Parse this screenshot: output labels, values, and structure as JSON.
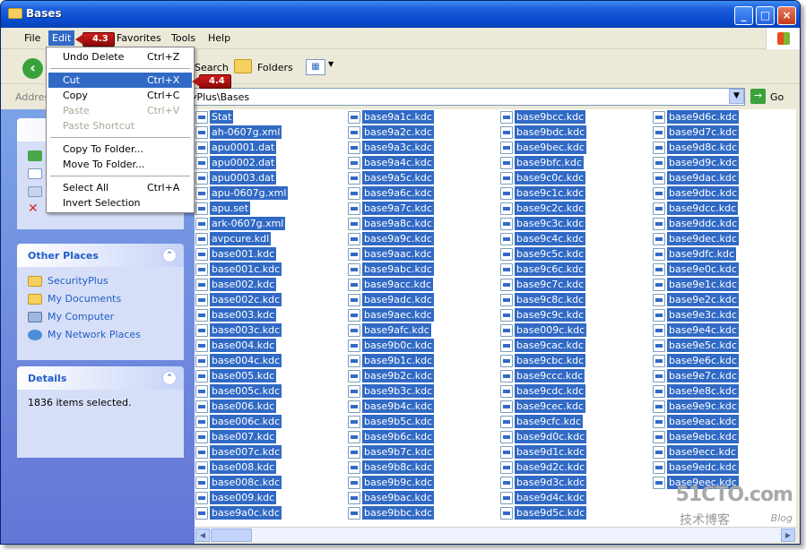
{
  "window": {
    "title": "Bases"
  },
  "menubar": {
    "items": [
      "File",
      "Edit",
      "Favorites",
      "Tools",
      "Help"
    ]
  },
  "toolbar": {
    "search_label": "Search",
    "folders_label": "Folders"
  },
  "address": {
    "label": "Address",
    "path_visible": "yPlus\\Bases",
    "go_label": "Go"
  },
  "edit_menu": {
    "items": [
      {
        "label": "Undo Delete",
        "shortcut": "Ctrl+Z",
        "state": "enabled"
      },
      {
        "label": "Cut",
        "shortcut": "Ctrl+X",
        "state": "highlighted"
      },
      {
        "label": "Copy",
        "shortcut": "Ctrl+C",
        "state": "enabled"
      },
      {
        "label": "Paste",
        "shortcut": "Ctrl+V",
        "state": "disabled"
      },
      {
        "label": "Paste Shortcut",
        "shortcut": "",
        "state": "disabled"
      },
      {
        "label": "Copy To Folder...",
        "shortcut": "",
        "state": "enabled"
      },
      {
        "label": "Move To Folder...",
        "shortcut": "",
        "state": "enabled"
      },
      {
        "label": "Select All",
        "shortcut": "Ctrl+A",
        "state": "enabled"
      },
      {
        "label": "Invert Selection",
        "shortcut": "",
        "state": "enabled"
      }
    ]
  },
  "callouts": {
    "menu": "4.3",
    "cut": "4.4"
  },
  "left_panel": {
    "other_places": {
      "title": "Other Places",
      "links": [
        "SecurityPlus",
        "My Documents",
        "My Computer",
        "My Network Places"
      ]
    },
    "details": {
      "title": "Details",
      "text": "1836 items selected."
    }
  },
  "files": {
    "col1": [
      "Stat",
      "ah-0607g.xml",
      "apu0001.dat",
      "apu0002.dat",
      "apu0003.dat",
      "apu-0607g.xml",
      "apu.set",
      "ark-0607g.xml",
      "avpcure.kdl",
      "base001.kdc",
      "base001c.kdc",
      "base002.kdc",
      "base002c.kdc",
      "base003.kdc",
      "base003c.kdc",
      "base004.kdc",
      "base004c.kdc",
      "base005.kdc",
      "base005c.kdc",
      "base006.kdc",
      "base006c.kdc",
      "base007.kdc",
      "base007c.kdc",
      "base008.kdc",
      "base008c.kdc",
      "base009.kdc",
      "base9a0c.kdc"
    ],
    "col2": [
      "base9a1c.kdc",
      "base9a2c.kdc",
      "base9a3c.kdc",
      "base9a4c.kdc",
      "base9a5c.kdc",
      "base9a6c.kdc",
      "base9a7c.kdc",
      "base9a8c.kdc",
      "base9a9c.kdc",
      "base9aac.kdc",
      "base9abc.kdc",
      "base9acc.kdc",
      "base9adc.kdc",
      "base9aec.kdc",
      "base9afc.kdc",
      "base9b0c.kdc",
      "base9b1c.kdc",
      "base9b2c.kdc",
      "base9b3c.kdc",
      "base9b4c.kdc",
      "base9b5c.kdc",
      "base9b6c.kdc",
      "base9b7c.kdc",
      "base9b8c.kdc",
      "base9b9c.kdc",
      "base9bac.kdc",
      "base9bbc.kdc"
    ],
    "col3": [
      "base9bcc.kdc",
      "base9bdc.kdc",
      "base9bec.kdc",
      "base9bfc.kdc",
      "base9c0c.kdc",
      "base9c1c.kdc",
      "base9c2c.kdc",
      "base9c3c.kdc",
      "base9c4c.kdc",
      "base9c5c.kdc",
      "base9c6c.kdc",
      "base9c7c.kdc",
      "base9c8c.kdc",
      "base9c9c.kdc",
      "base009c.kdc",
      "base9cac.kdc",
      "base9cbc.kdc",
      "base9ccc.kdc",
      "base9cdc.kdc",
      "base9cec.kdc",
      "base9cfc.kdc",
      "base9d0c.kdc",
      "base9d1c.kdc",
      "base9d2c.kdc",
      "base9d3c.kdc",
      "base9d4c.kdc",
      "base9d5c.kdc"
    ],
    "col4": [
      "base9d6c.kdc",
      "base9d7c.kdc",
      "base9d8c.kdc",
      "base9d9c.kdc",
      "base9dac.kdc",
      "base9dbc.kdc",
      "base9dcc.kdc",
      "base9ddc.kdc",
      "base9dec.kdc",
      "base9dfc.kdc",
      "base9e0c.kdc",
      "base9e1c.kdc",
      "base9e2c.kdc",
      "base9e3c.kdc",
      "base9e4c.kdc",
      "base9e5c.kdc",
      "base9e6c.kdc",
      "base9e7c.kdc",
      "base9e8c.kdc",
      "base9e9c.kdc",
      "base9eac.kdc",
      "base9ebc.kdc",
      "base9ecc.kdc",
      "base9edc.kdc",
      "base9eec.kdc"
    ]
  },
  "watermark": {
    "site": "51CTO.com",
    "tagline": "技术博客",
    "blog": "Blog"
  },
  "colors": {
    "selection": "#316ac5",
    "titlebar": "#0a4cd0",
    "callout": "#b01515",
    "taskpane": "#6375d6"
  }
}
